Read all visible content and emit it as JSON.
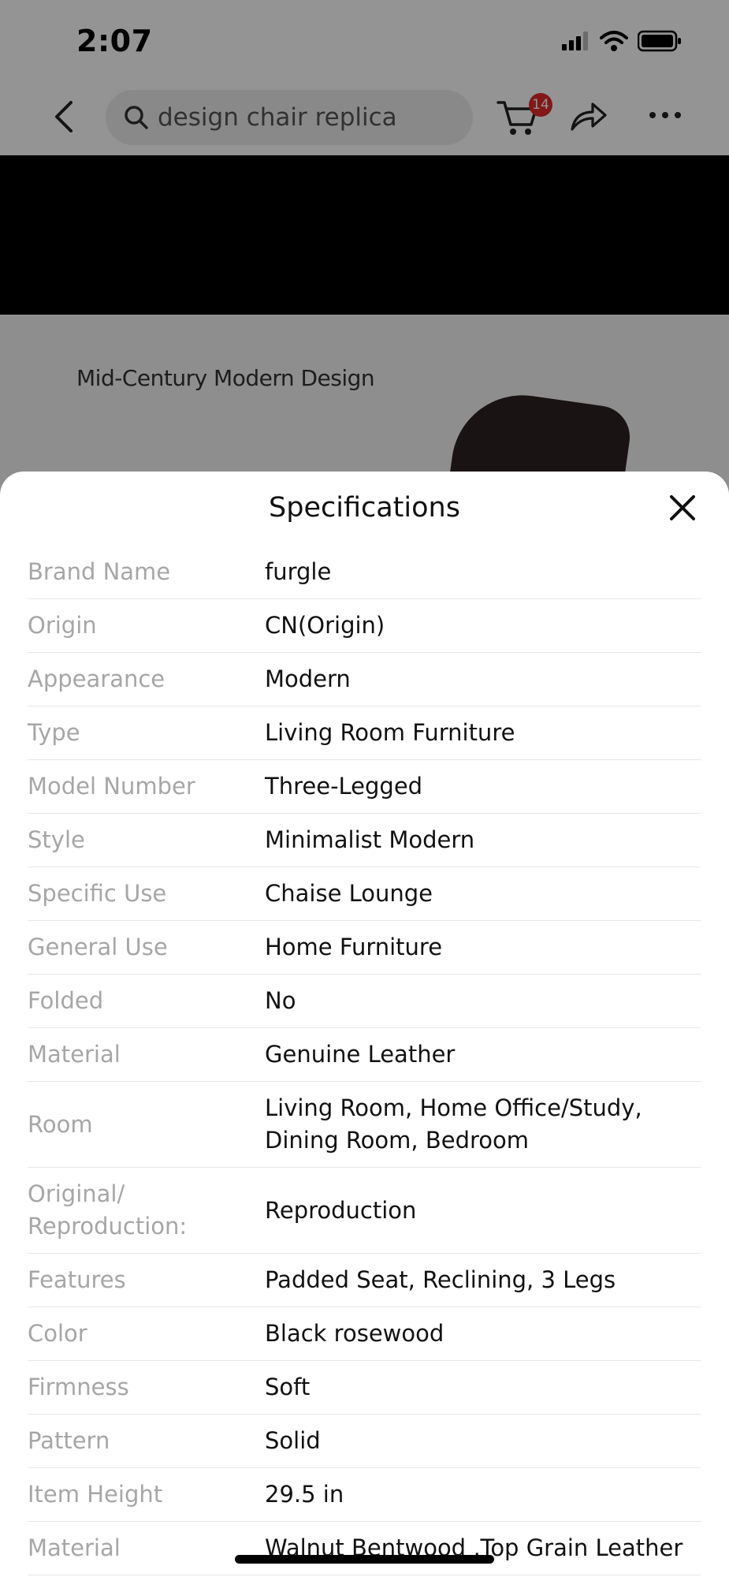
{
  "status_bar": {
    "time": "2:07"
  },
  "nav": {
    "search_value": "design chair replica",
    "cart_count": "14"
  },
  "product": {
    "caption": "Mid-Century Modern Design"
  },
  "sheet": {
    "title": "Specifications",
    "specs": [
      {
        "label": "Brand Name",
        "value": "furgle"
      },
      {
        "label": "Origin",
        "value": "CN(Origin)"
      },
      {
        "label": "Appearance",
        "value": "Modern"
      },
      {
        "label": "Type",
        "value": "Living Room Furniture"
      },
      {
        "label": "Model Number",
        "value": "Three-Legged"
      },
      {
        "label": "Style",
        "value": "Minimalist Modern"
      },
      {
        "label": "Specific Use",
        "value": "Chaise Lounge"
      },
      {
        "label": "General Use",
        "value": "Home Furniture"
      },
      {
        "label": "Folded",
        "value": "No"
      },
      {
        "label": "Material",
        "value": "Genuine Leather"
      },
      {
        "label": "Room",
        "value": "Living Room, Home Office/Study, Dining Room, Bedroom"
      },
      {
        "label": "Original/ Reproduction:",
        "value": "Reproduction"
      },
      {
        "label": "Features",
        "value": "Padded Seat, Reclining, 3 Legs"
      },
      {
        "label": "Color",
        "value": "Black rosewood"
      },
      {
        "label": "Firmness",
        "value": "Soft"
      },
      {
        "label": "Pattern",
        "value": "Solid"
      },
      {
        "label": "Item Height",
        "value": "29.5 in"
      },
      {
        "label": "Material",
        "value": "Walnut Bentwood ,Top Grain Leather"
      }
    ]
  },
  "colors": {
    "badge": "#e02a2a",
    "overlay": "rgba(0,0,0,0.42)"
  }
}
